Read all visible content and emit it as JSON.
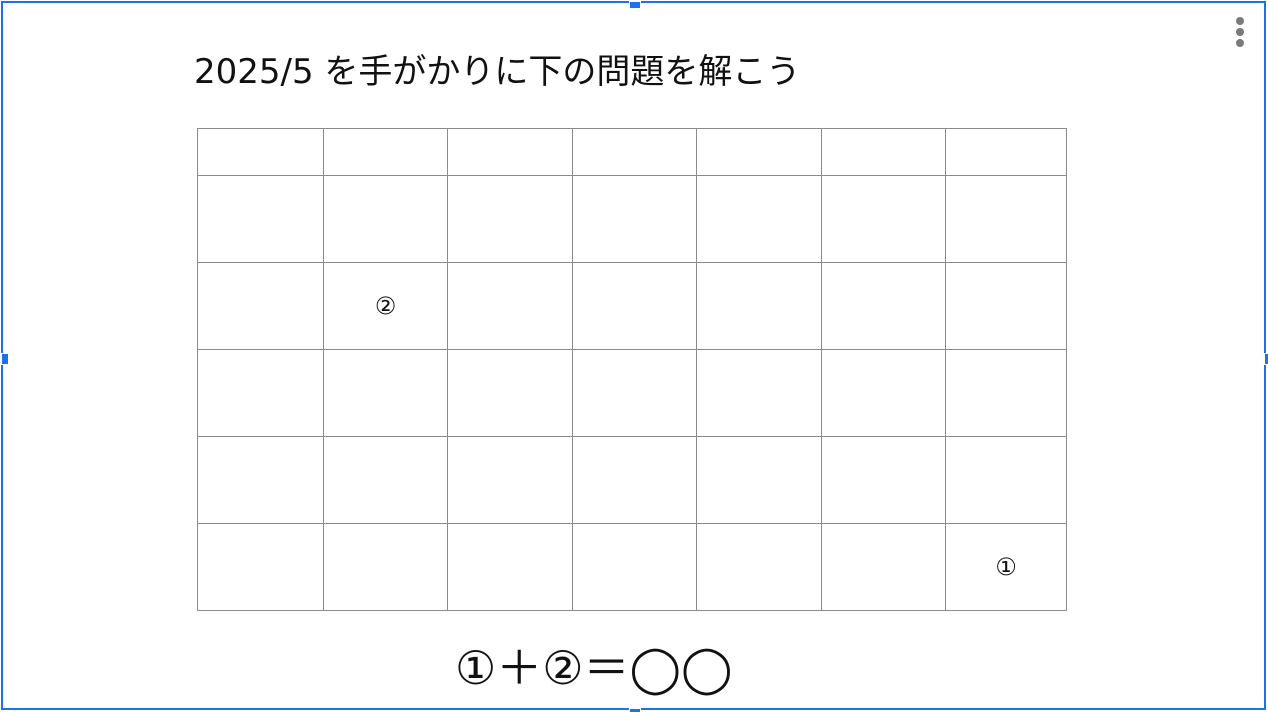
{
  "title": "2025/5 を手がかりに下の問題を解こう",
  "calendar": {
    "rows": [
      [
        "",
        "",
        "",
        "",
        "",
        "",
        ""
      ],
      [
        "",
        "",
        "",
        "",
        "",
        "",
        ""
      ],
      [
        "",
        "②",
        "",
        "",
        "",
        "",
        ""
      ],
      [
        "",
        "",
        "",
        "",
        "",
        "",
        ""
      ],
      [
        "",
        "",
        "",
        "",
        "",
        "",
        ""
      ],
      [
        "",
        "",
        "",
        "",
        "",
        "",
        "①"
      ]
    ]
  },
  "equation": "①＋②＝◯◯",
  "menu_icon": "more-vert-icon",
  "colors": {
    "selection": "#1a73e8",
    "grid": "#8a8a8a",
    "text": "#111111"
  }
}
